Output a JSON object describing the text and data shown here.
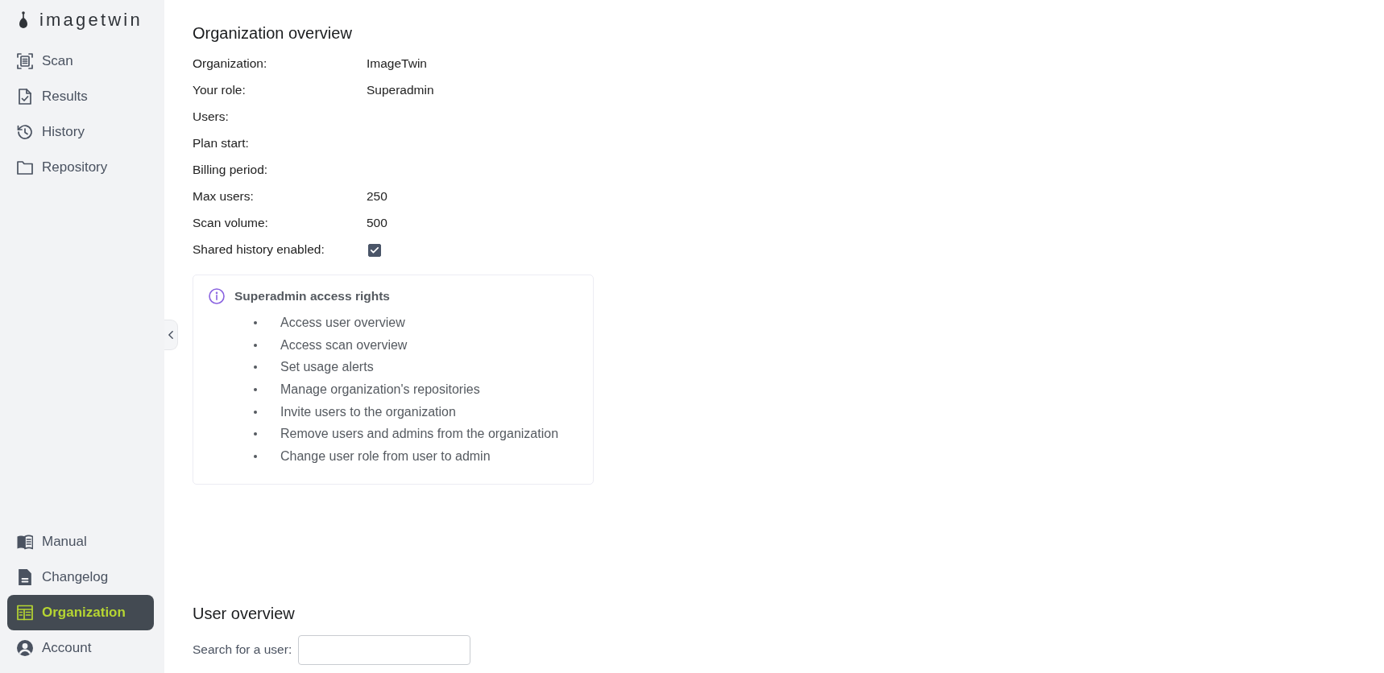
{
  "sidebar": {
    "logo": "imagetwin",
    "items": [
      {
        "label": "Scan",
        "selected": false
      },
      {
        "label": "Results",
        "selected": false
      },
      {
        "label": "History",
        "selected": false
      },
      {
        "label": "Repository",
        "selected": false
      }
    ],
    "bottom_items": [
      {
        "label": "Manual",
        "selected": false
      },
      {
        "label": "Changelog",
        "selected": false
      },
      {
        "label": "Organization",
        "selected": true
      },
      {
        "label": "Account",
        "selected": false
      }
    ]
  },
  "organization_overview": {
    "title": "Organization overview",
    "fields": [
      {
        "kind": "text",
        "label": "Organization:",
        "value": "ImageTwin"
      },
      {
        "kind": "text",
        "label": "Your role:",
        "value": "Superadmin"
      },
      {
        "kind": "text",
        "label": "Users:"
      },
      {
        "kind": "text",
        "label": "Plan start:"
      },
      {
        "kind": "text",
        "label": "Billing period:"
      },
      {
        "kind": "text",
        "label": "Max users:",
        "value": "250"
      },
      {
        "kind": "text",
        "label": "Scan volume:",
        "value": "500"
      },
      {
        "kind": "checkbox",
        "label": "Shared history enabled:",
        "checked": true
      }
    ]
  },
  "info_box": {
    "title": "Superadmin access rights",
    "items": [
      "Access user overview",
      "Access scan overview",
      "Set usage alerts",
      "Manage organization's repositories",
      "Invite users to the organization",
      "Remove users and admins from the organization",
      "Change user role from user to admin"
    ]
  },
  "user_overview": {
    "title": "User overview",
    "search": {
      "label": "Search for a user:"
    }
  }
}
